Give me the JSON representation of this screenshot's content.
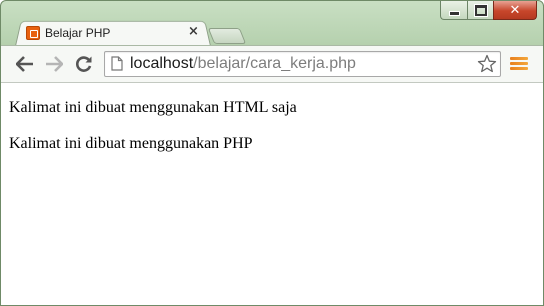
{
  "tab": {
    "title": "Belajar PHP",
    "close_glyph": "×",
    "favicon": "xampp-icon"
  },
  "window_controls": {
    "minimize": "minimize-icon",
    "maximize": "maximize-icon",
    "close_glyph": "✕"
  },
  "toolbar": {
    "back": "back-arrow-icon",
    "forward": "forward-arrow-icon",
    "reload": "reload-icon",
    "url_host": "localhost",
    "url_path": "/belajar/cara_kerja.php",
    "bookmark": "star-icon",
    "menu": "hamburger-menu-icon"
  },
  "page": {
    "paragraphs": [
      "Kalimat ini dibuat menggunakan HTML saja",
      "Kalimat ini dibuat menggunakan PHP"
    ]
  },
  "colors": {
    "frame": "#b7d2b0",
    "toolbar": "#f6f8f5",
    "close_button": "#c7462b",
    "menu_accent": "#e8801d",
    "url_path": "#7d7d7d"
  }
}
